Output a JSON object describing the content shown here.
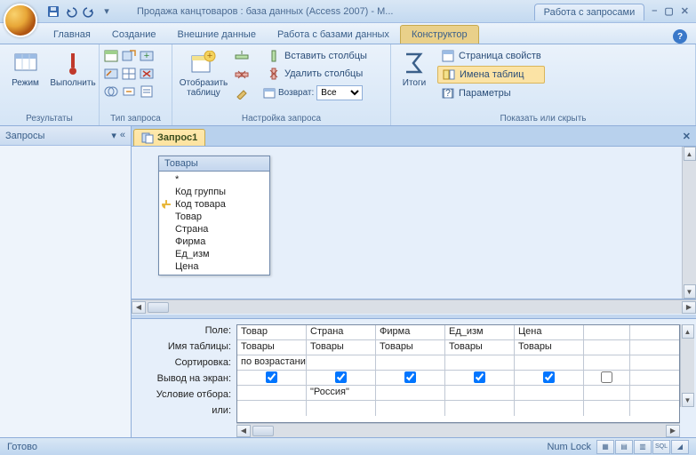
{
  "title": "Продажа канцтоваров : база данных (Access 2007) - M...",
  "context_tab": "Работа с запросами",
  "tabs": [
    "Главная",
    "Создание",
    "Внешние данные",
    "Работа с базами данных",
    "Конструктор"
  ],
  "active_tab": "Конструктор",
  "ribbon": {
    "groups": {
      "results": {
        "label": "Результаты",
        "mode": "Режим",
        "run": "Выполнить"
      },
      "qtype": {
        "label": "Тип запроса"
      },
      "setup": {
        "label": "Настройка запроса",
        "show_table": "Отобразить таблицу",
        "insert_cols": "Вставить столбцы",
        "delete_cols": "Удалить столбцы",
        "return": "Возврат:",
        "return_val": "Все"
      },
      "showhide": {
        "label": "Показать или скрыть",
        "totals": "Итоги",
        "prop_page": "Страница свойств",
        "table_names": "Имена таблиц",
        "params": "Параметры"
      }
    }
  },
  "nav": {
    "title": "Запросы"
  },
  "doc": {
    "tab": "Запрос1"
  },
  "tablebox": {
    "title": "Товары",
    "fields": [
      "*",
      "Код группы",
      "Код товара",
      "Товар",
      "Страна",
      "Фирма",
      "Ед_изм",
      "Цена"
    ],
    "key_index": 2
  },
  "grid": {
    "labels": [
      "Поле:",
      "Имя таблицы:",
      "Сортировка:",
      "Вывод на экран:",
      "Условие отбора:",
      "или:"
    ],
    "cols": [
      {
        "field": "Товар",
        "table": "Товары",
        "sort": "по возрастанию",
        "show": true,
        "crit": ""
      },
      {
        "field": "Страна",
        "table": "Товары",
        "sort": "",
        "show": true,
        "crit": "\"Россия\""
      },
      {
        "field": "Фирма",
        "table": "Товары",
        "sort": "",
        "show": true,
        "crit": ""
      },
      {
        "field": "Ед_изм",
        "table": "Товары",
        "sort": "",
        "show": true,
        "crit": ""
      },
      {
        "field": "Цена",
        "table": "Товары",
        "sort": "",
        "show": true,
        "crit": ""
      },
      {
        "field": "",
        "table": "",
        "sort": "",
        "show": false,
        "crit": ""
      }
    ]
  },
  "status": {
    "left": "Готово",
    "right": "Num Lock"
  }
}
